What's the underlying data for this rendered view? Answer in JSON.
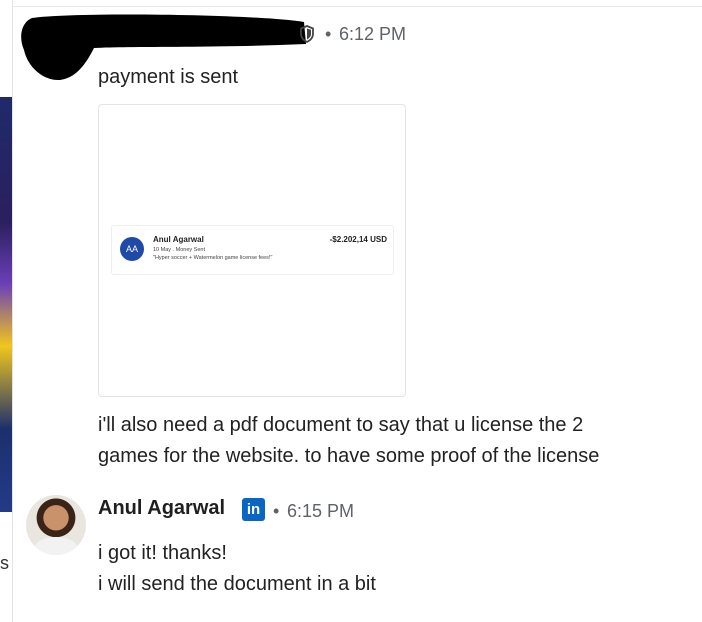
{
  "colors": {
    "accent_linkedin": "#0a66c2",
    "meta_gray": "#5f6368",
    "text": "#222222"
  },
  "left_window": {
    "visible_char": "s"
  },
  "message_1": {
    "sender": "",
    "badge_icon": "shield-icon",
    "separator": "•",
    "time": "6:12 PM",
    "text": "payment is sent",
    "attachment": {
      "receipt": {
        "avatar_initials": "AA",
        "name": "Anul Agarwal",
        "subtitle": "10 May . Money Sent",
        "note": "\"Hyper soccer + Watermelon game license fees!\"",
        "amount": "-$2.202,14 USD"
      }
    },
    "follow_up_line_1": "i'll also need a pdf document to say that u license the 2",
    "follow_up_line_2": "games for the website. to have some proof of the license"
  },
  "message_2": {
    "sender": "Anul Agarwal",
    "badge_icon": "linkedin-icon",
    "badge_text": "in",
    "separator": "•",
    "time": "6:15 PM",
    "line_1": "i got it! thanks!",
    "line_2": "i will send the document in a bit"
  }
}
